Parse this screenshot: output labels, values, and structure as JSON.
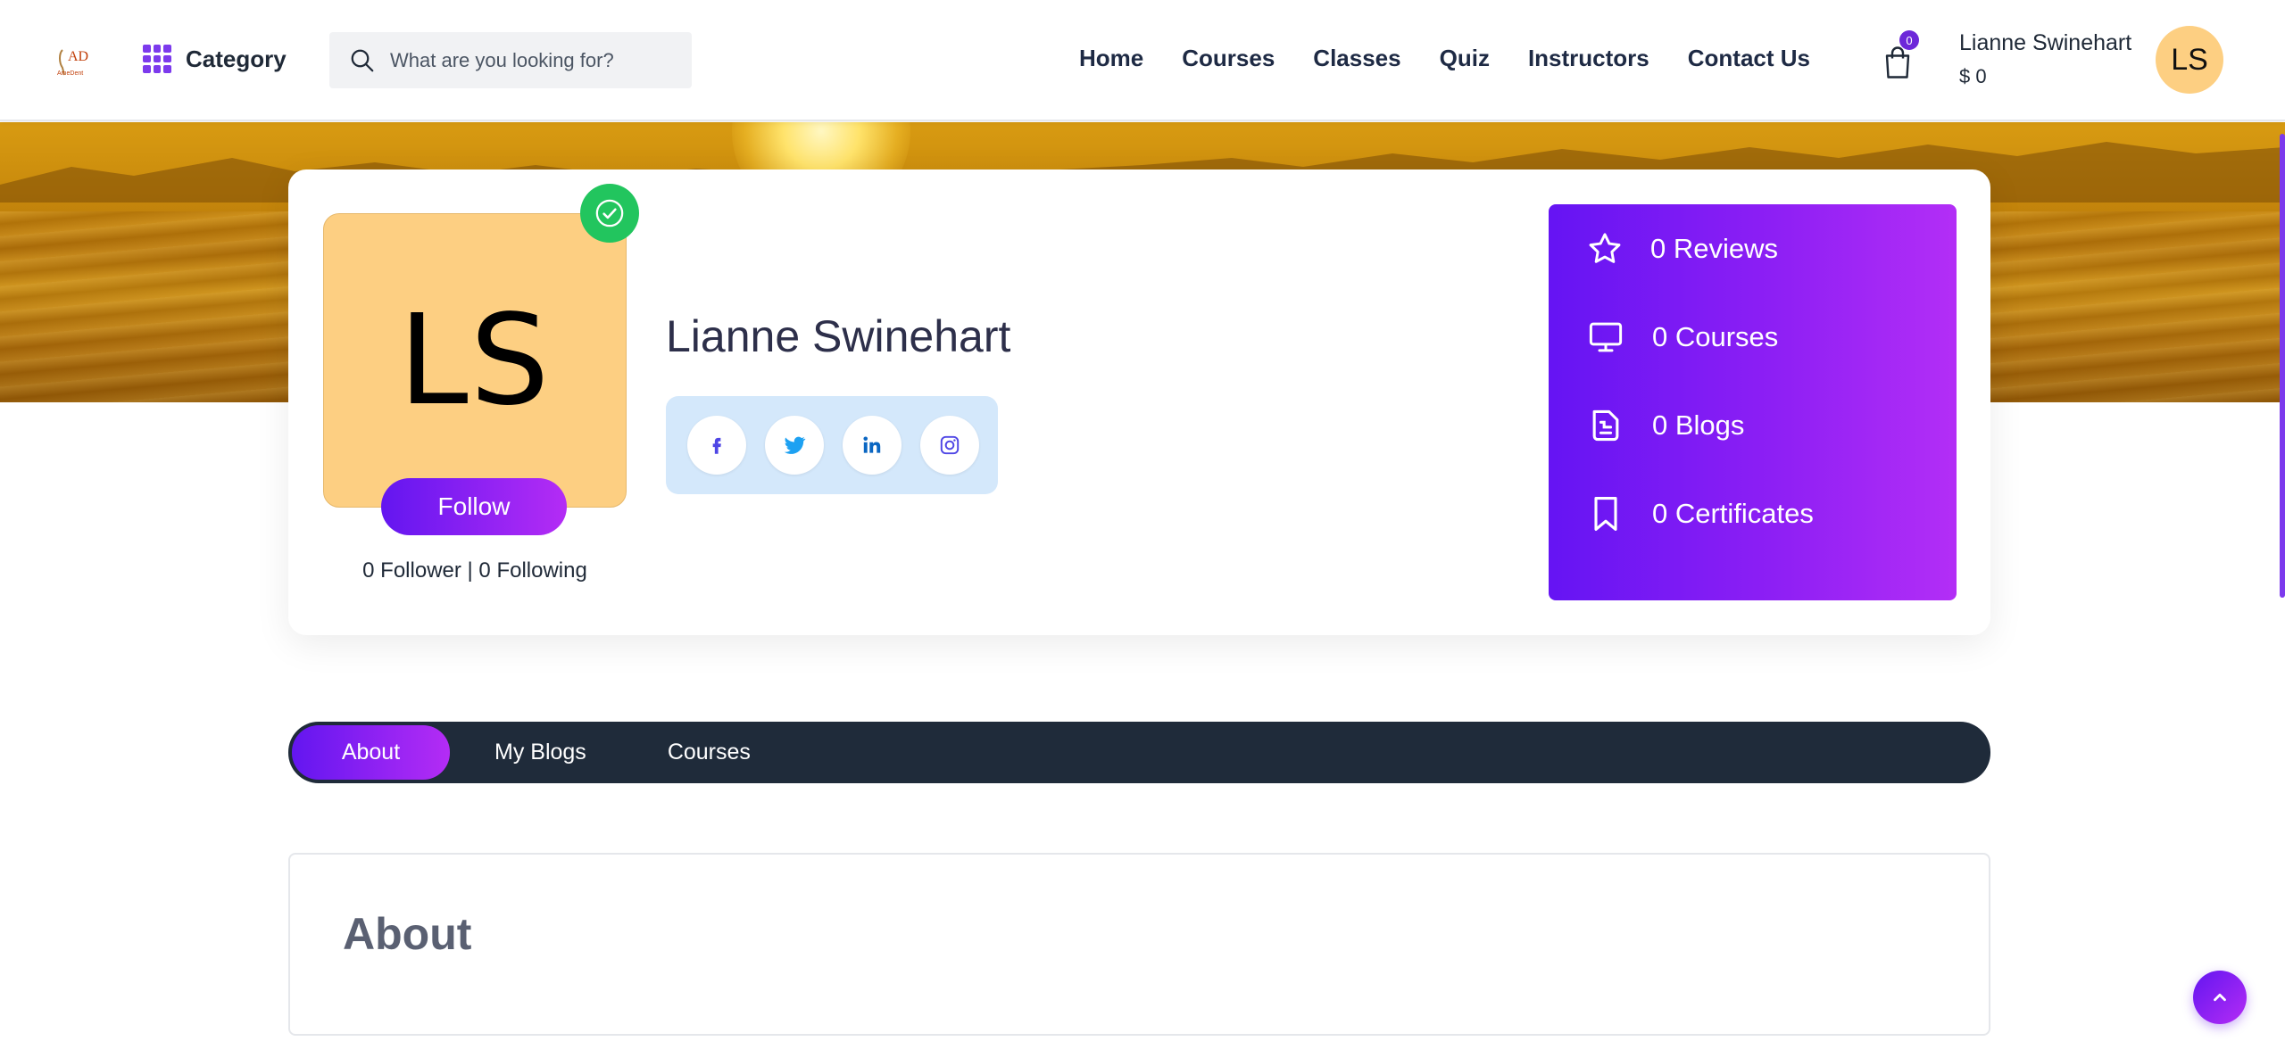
{
  "header": {
    "logo_icon": "ad-logo-icon",
    "category_label": "Category",
    "search_placeholder": "What are you looking for?",
    "nav": [
      {
        "label": "Home"
      },
      {
        "label": "Courses"
      },
      {
        "label": "Classes"
      },
      {
        "label": "Quiz"
      },
      {
        "label": "Instructors"
      },
      {
        "label": "Contact Us"
      }
    ],
    "cart_count": "0",
    "user_name": "Lianne Swinehart",
    "user_balance": "$ 0",
    "avatar_initials": "LS"
  },
  "profile": {
    "initials": "LS",
    "name": "Lianne Swinehart",
    "follow_label": "Follow",
    "follow_stats": "0 Follower | 0 Following",
    "social": [
      {
        "icon": "facebook-icon",
        "color": "#4f46e5"
      },
      {
        "icon": "twitter-icon",
        "color": "#1da1f2"
      },
      {
        "icon": "linkedin-icon",
        "color": "#0a66c2"
      },
      {
        "icon": "instagram-icon",
        "color": "#4f46e5"
      }
    ],
    "stats": [
      {
        "icon": "star-icon",
        "label": "0 Reviews"
      },
      {
        "icon": "monitor-icon",
        "label": "0 Courses"
      },
      {
        "icon": "blog-icon",
        "label": "0 Blogs"
      },
      {
        "icon": "bookmark-icon",
        "label": "0 Certificates"
      }
    ]
  },
  "tabs": [
    {
      "label": "About",
      "active": true
    },
    {
      "label": "My Blogs",
      "active": false
    },
    {
      "label": "Courses",
      "active": false
    }
  ],
  "about": {
    "title": "About"
  },
  "colors": {
    "accent_start": "#6316f0",
    "accent_end": "#b42cf5",
    "avatar_bg": "#fdcf82",
    "verified": "#22c55e",
    "tabs_bg": "#1f2b3a",
    "social_bg": "#d4e8fb"
  }
}
